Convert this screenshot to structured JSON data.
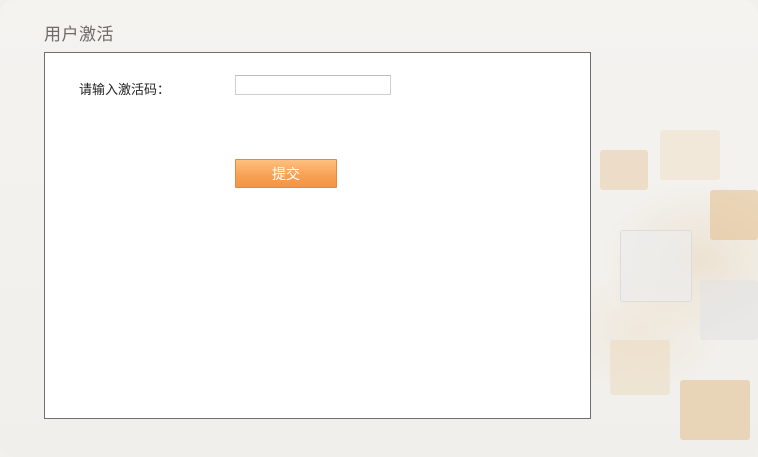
{
  "page": {
    "title": "用户激活"
  },
  "form": {
    "activation_code_label": "请输入激活码：",
    "activation_code_value": "",
    "activation_code_placeholder": "",
    "submit_label": "提交"
  },
  "colors": {
    "button_top": "#ffc07e",
    "button_bottom": "#f39445",
    "panel_border": "#6f6f6f",
    "title_text": "#6e6a65"
  }
}
